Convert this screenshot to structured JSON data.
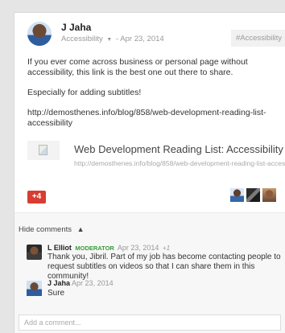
{
  "post": {
    "author": "J Jaha",
    "audience": "Accessibility",
    "date": "Apr 23, 2014",
    "hashtag": "#Accessibility",
    "paragraphs": [
      "If you ever come across business or personal page without accessibility, this link is the best one out there to share.",
      "Especially for adding subtitles!",
      "http://demosthenes.info/blog/858/web-development-reading-list-accessibility"
    ],
    "link_preview": {
      "title": "Web Development Reading List: Accessibility",
      "url": "http://demosthenes.info/blog/858/web-development-reading-list-acces..."
    },
    "plus_count": "+4"
  },
  "comments": {
    "hide_label": "Hide comments",
    "items": [
      {
        "name": "L Elliot",
        "role": "MODERATOR",
        "date": "Apr 23, 2014",
        "plus": "+1",
        "text": "Thank you, Jibril. Part of my job has become contacting people to request subtitles on videos so that I can share them in this community!"
      },
      {
        "name": "J Jaha",
        "date": "Apr 23, 2014",
        "text": "Sure"
      }
    ],
    "add_placeholder": "Add a comment..."
  }
}
